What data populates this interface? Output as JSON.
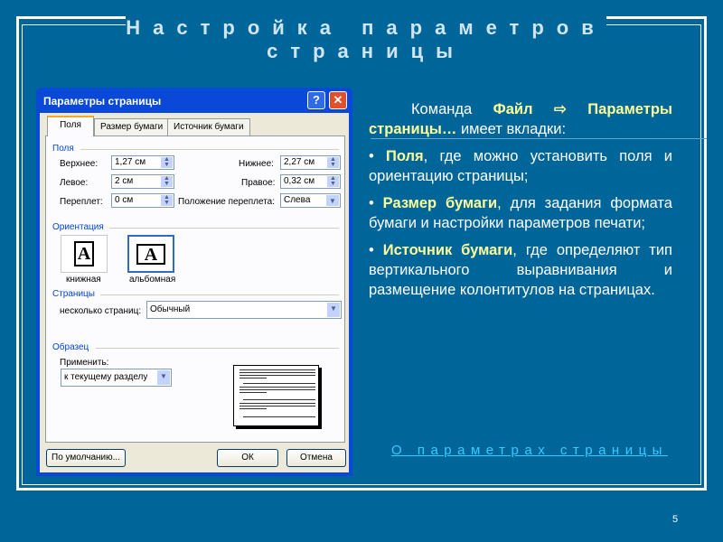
{
  "slide": {
    "title": "Настройка параметров страницы",
    "page_number": "5",
    "link": "О параметрах страницы",
    "intro": {
      "pre": "Команда ",
      "file": "Файл",
      "arrow": "⇨",
      "params": "Параметры страницы…",
      "post": " имеет вкладки:"
    },
    "bullets": [
      {
        "bullet": "• ",
        "term": "Поля",
        "rest": ", где можно  установить поля и ориентацию страницы;"
      },
      {
        "bullet": "• ",
        "term": "Размер бумаги",
        "rest": ", для задания формата бумаги  и настройки параметров печати;"
      },
      {
        "bullet": "• ",
        "term": "Источник бумаги",
        "rest": ", где определяют тип вертикального выравнивания и размещение колонтитулов на страницах."
      }
    ]
  },
  "dialog": {
    "title": "Параметры страницы",
    "help": "?",
    "close": "✕",
    "tabs": [
      "Поля",
      "Размер бумаги",
      "Источник бумаги"
    ],
    "margins": {
      "group": "Поля",
      "top_label": "Верхнее:",
      "top": "1,27 см",
      "bottom_label": "Нижнее:",
      "bottom": "2,27 см",
      "left_label": "Левое:",
      "left": "2 см",
      "right_label": "Правое:",
      "right": "0,32 см",
      "gutter_label": "Переплет:",
      "gutter": "0 см",
      "gutter_pos_label": "Положение переплета:",
      "gutter_pos": "Слева"
    },
    "orientation": {
      "group": "Ориентация",
      "portrait": "книжная",
      "landscape": "альбомная",
      "icon_letter": "A",
      "selected": "альбомная"
    },
    "pages": {
      "group": "Страницы",
      "label": "несколько страниц:",
      "value": "Обычный"
    },
    "sample": {
      "group": "Образец",
      "apply_label": "Применить:",
      "apply_value": "к текущему разделу"
    },
    "buttons": {
      "default": "По умолчанию...",
      "ok": "ОК",
      "cancel": "Отмена"
    }
  },
  "colors": {
    "background": "#006699",
    "highlight": "#ffff99",
    "link": "#33ccff"
  }
}
